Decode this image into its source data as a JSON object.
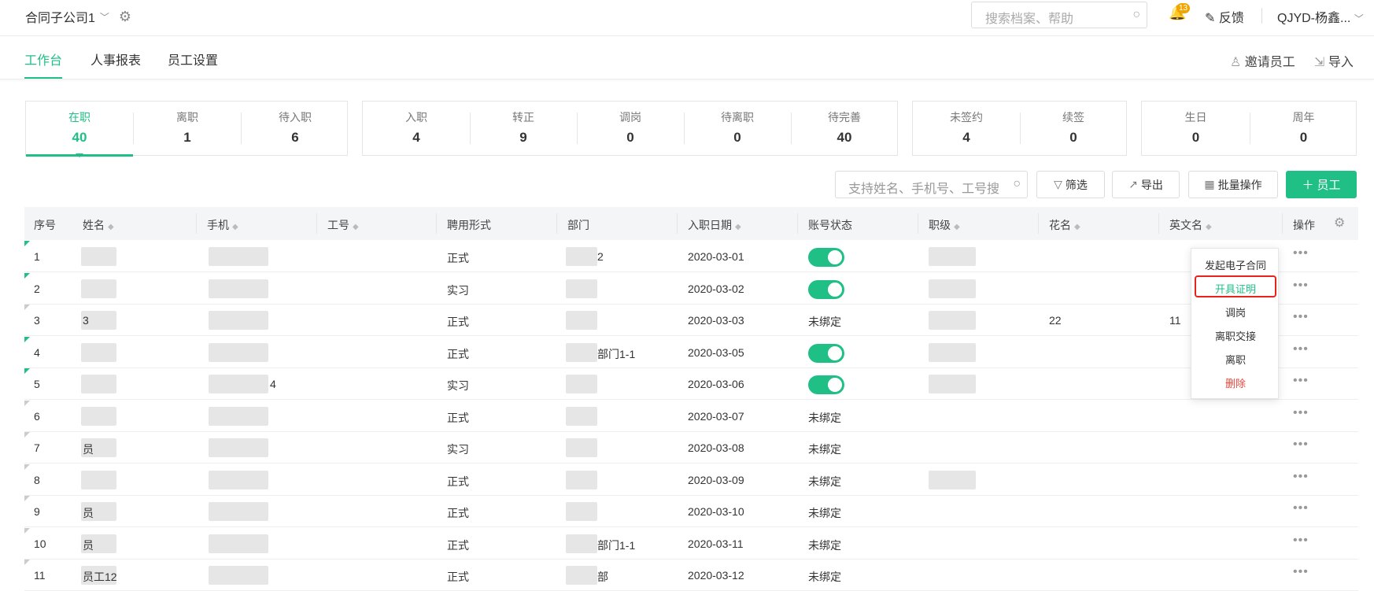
{
  "header": {
    "company": "合同子公司1",
    "search_placeholder": "搜索档案、帮助",
    "notification_count": "13",
    "feedback": "反馈",
    "user": "QJYD-杨鑫..."
  },
  "tabs": [
    "工作台",
    "人事报表",
    "员工设置"
  ],
  "tab_actions": {
    "invite": "邀请员工",
    "import": "导入"
  },
  "stats": {
    "group1": [
      {
        "label": "在职",
        "value": "40"
      },
      {
        "label": "离职",
        "value": "1"
      },
      {
        "label": "待入职",
        "value": "6"
      }
    ],
    "group2": [
      {
        "label": "入职",
        "value": "4"
      },
      {
        "label": "转正",
        "value": "9"
      },
      {
        "label": "调岗",
        "value": "0"
      },
      {
        "label": "待离职",
        "value": "0"
      },
      {
        "label": "待完善",
        "value": "40"
      }
    ],
    "group3": [
      {
        "label": "未签约",
        "value": "4"
      },
      {
        "label": "续签",
        "value": "0"
      }
    ],
    "group4": [
      {
        "label": "生日",
        "value": "0"
      },
      {
        "label": "周年",
        "value": "0"
      }
    ]
  },
  "toolbar": {
    "search_placeholder": "支持姓名、手机号、工号搜",
    "filter": "筛选",
    "export": "导出",
    "batch": "批量操作",
    "add_employee": "员工"
  },
  "table": {
    "headers": [
      "序号",
      "姓名",
      "手机",
      "工号",
      "聘用形式",
      "部门",
      "入职日期",
      "账号状态",
      "职级",
      "花名",
      "英文名",
      "操作"
    ],
    "rows": [
      {
        "no": "1",
        "name": "",
        "phone": "",
        "type": "正式",
        "dept": "2",
        "date": "2020-03-01",
        "status": "",
        "nickname": "",
        "english": "",
        "toggle": true,
        "corner": "green"
      },
      {
        "no": "2",
        "name": "",
        "phone": "",
        "type": "实习",
        "dept": "",
        "date": "2020-03-02",
        "status": "",
        "nickname": "",
        "english": "",
        "toggle": true,
        "corner": "green"
      },
      {
        "no": "3",
        "name": "3",
        "phone": "",
        "type": "正式",
        "dept": "",
        "date": "2020-03-03",
        "status": "未绑定",
        "nickname": "22",
        "english": "11",
        "toggle": false,
        "corner": "gray"
      },
      {
        "no": "4",
        "name": "",
        "phone": "",
        "type": "正式",
        "dept": "部门1-1",
        "date": "2020-03-05",
        "status": "",
        "nickname": "",
        "english": "",
        "toggle": true,
        "corner": "green"
      },
      {
        "no": "5",
        "name": "",
        "phone": "4",
        "type": "实习",
        "dept": "",
        "date": "2020-03-06",
        "status": "",
        "nickname": "",
        "english": "",
        "toggle": true,
        "corner": "green"
      },
      {
        "no": "6",
        "name": "",
        "phone": "",
        "type": "正式",
        "dept": "",
        "date": "2020-03-07",
        "status": "未绑定",
        "nickname": "",
        "english": "",
        "toggle": false,
        "corner": "gray"
      },
      {
        "no": "7",
        "name": "员",
        "phone": "",
        "type": "实习",
        "dept": "",
        "date": "2020-03-08",
        "status": "未绑定",
        "nickname": "",
        "english": "",
        "toggle": false,
        "corner": "gray"
      },
      {
        "no": "8",
        "name": "",
        "phone": "",
        "type": "正式",
        "dept": "",
        "date": "2020-03-09",
        "status": "未绑定",
        "nickname": "",
        "english": "",
        "toggle": false,
        "corner": "gray"
      },
      {
        "no": "9",
        "name": "员",
        "phone": "",
        "type": "正式",
        "dept": "",
        "date": "2020-03-10",
        "status": "未绑定",
        "nickname": "",
        "english": "",
        "toggle": false,
        "corner": "gray"
      },
      {
        "no": "10",
        "name": "员",
        "phone": "",
        "type": "正式",
        "dept": "部门1-1",
        "date": "2020-03-11",
        "status": "未绑定",
        "nickname": "",
        "english": "",
        "toggle": false,
        "corner": "gray"
      },
      {
        "no": "11",
        "name": "员工12",
        "phone": "",
        "type": "正式",
        "dept": "部",
        "date": "2020-03-12",
        "status": "未绑定",
        "nickname": "",
        "english": "",
        "toggle": false,
        "corner": "gray"
      }
    ]
  },
  "action_menu": {
    "items": [
      "发起电子合同",
      "开具证明",
      "调岗",
      "离职交接",
      "离职",
      "删除"
    ]
  },
  "colors": {
    "accent": "#1fbf86",
    "danger": "#f0443a",
    "highlight_box": "#e8231b",
    "badge": "#f2a500"
  }
}
